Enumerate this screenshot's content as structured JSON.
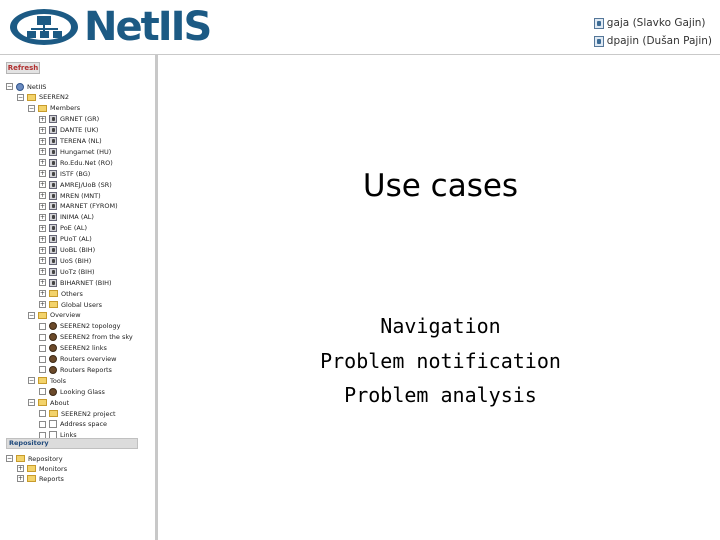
{
  "header": {
    "logo_text": "NetIIS",
    "users": [
      "gaja (Slavko Gajin)",
      "dpajin (Dušan Pajin)"
    ]
  },
  "sidebar": {
    "refresh_label": "Refresh",
    "repository_label": "Repository",
    "tree": [
      {
        "label": "NetIIS",
        "icon": "globe-icon",
        "toggle": "minus"
      },
      {
        "label": "SEEREN2",
        "icon": "folder-icon",
        "toggle": "minus"
      },
      {
        "label": "Members",
        "icon": "folder-icon",
        "toggle": "minus"
      },
      {
        "label": "GRNET (GR)",
        "icon": "member-icon",
        "toggle": "plus"
      },
      {
        "label": "DANTE (UK)",
        "icon": "member-icon",
        "toggle": "plus"
      },
      {
        "label": "TERENA (NL)",
        "icon": "member-icon",
        "toggle": "plus"
      },
      {
        "label": "Hungarnet (HU)",
        "icon": "member-icon",
        "toggle": "plus"
      },
      {
        "label": "Ro.Edu.Net (RO)",
        "icon": "member-icon",
        "toggle": "plus"
      },
      {
        "label": "ISTF (BG)",
        "icon": "member-icon",
        "toggle": "plus"
      },
      {
        "label": "AMREJ/UoB (SR)",
        "icon": "member-icon",
        "toggle": "plus"
      },
      {
        "label": "MREN (MNT)",
        "icon": "member-icon",
        "toggle": "plus"
      },
      {
        "label": "MARNET (FYROM)",
        "icon": "member-icon",
        "toggle": "plus"
      },
      {
        "label": "INIMA (AL)",
        "icon": "member-icon",
        "toggle": "plus"
      },
      {
        "label": "PoE (AL)",
        "icon": "member-icon",
        "toggle": "plus"
      },
      {
        "label": "PUoT (AL)",
        "icon": "member-icon",
        "toggle": "plus"
      },
      {
        "label": "UoBL (BIH)",
        "icon": "member-icon",
        "toggle": "plus"
      },
      {
        "label": "UoS (BIH)",
        "icon": "member-icon",
        "toggle": "plus"
      },
      {
        "label": "UoTz (BIH)",
        "icon": "member-icon",
        "toggle": "plus"
      },
      {
        "label": "BIHARNET (BIH)",
        "icon": "member-icon",
        "toggle": "plus"
      },
      {
        "label": "Others",
        "icon": "folder-icon",
        "toggle": "plus"
      },
      {
        "label": "Global Users",
        "icon": "folder-icon",
        "toggle": "plus"
      },
      {
        "label": "Overview",
        "icon": "folder-icon",
        "toggle": "minus"
      },
      {
        "label": "SEEREN2 topology",
        "icon": "network-icon",
        "toggle": "leaf"
      },
      {
        "label": "SEEREN2 from the sky",
        "icon": "network-icon",
        "toggle": "leaf"
      },
      {
        "label": "SEEREN2 links",
        "icon": "network-icon",
        "toggle": "leaf"
      },
      {
        "label": "Routers overview",
        "icon": "network-icon",
        "toggle": "leaf"
      },
      {
        "label": "Routers Reports",
        "icon": "network-icon",
        "toggle": "leaf"
      },
      {
        "label": "Tools",
        "icon": "folder-icon",
        "toggle": "minus"
      },
      {
        "label": "Looking Glass",
        "icon": "network-icon",
        "toggle": "leaf"
      },
      {
        "label": "About",
        "icon": "folder-icon",
        "toggle": "minus"
      },
      {
        "label": "SEEREN2 project",
        "icon": "folder-icon",
        "toggle": "leaf"
      },
      {
        "label": "Address space",
        "icon": "page-icon",
        "toggle": "leaf"
      },
      {
        "label": "Links",
        "icon": "page-icon",
        "toggle": "leaf"
      }
    ],
    "repo_tree": [
      {
        "label": "Repository",
        "icon": "repository-icon",
        "toggle": "minus"
      },
      {
        "label": "Monitors",
        "icon": "folder-icon",
        "toggle": "plus"
      },
      {
        "label": "Reports",
        "icon": "folder-icon",
        "toggle": "plus"
      }
    ]
  },
  "main": {
    "title": "Use cases",
    "bullets": [
      "Navigation",
      "Problem notification",
      "Problem analysis"
    ]
  },
  "colors": {
    "brand": "#1c5a84",
    "refresh_text": "#b03030",
    "folder": "#f3d36b"
  }
}
